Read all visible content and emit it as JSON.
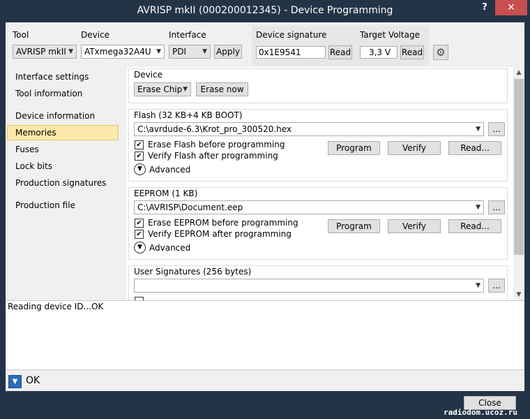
{
  "window": {
    "title": "AVRISP mkII (000200012345) - Device Programming",
    "help_glyph": "?",
    "close_glyph": "✕"
  },
  "toolbar": {
    "tool_label": "Tool",
    "tool_value": "AVRISP mkII",
    "device_label": "Device",
    "device_value": "ATxmega32A4U",
    "interface_label": "Interface",
    "interface_value": "PDI",
    "apply_label": "Apply",
    "signature_label": "Device signature",
    "signature_value": "0x1E9541",
    "signature_read": "Read",
    "voltage_label": "Target Voltage",
    "voltage_value": "3,3 V",
    "voltage_read": "Read"
  },
  "nav": {
    "items": [
      "Interface settings",
      "Tool information",
      "Device information",
      "Memories",
      "Fuses",
      "Lock bits",
      "Production signatures",
      "Production file"
    ],
    "selected": "Memories"
  },
  "device_group": {
    "title": "Device",
    "erase_combo": "Erase Chip",
    "erase_now": "Erase now"
  },
  "flash_group": {
    "title": "Flash (32 KB+4 KB BOOT)",
    "path": "C:\\avrdude-6.3\\Krot_pro_300520.hex",
    "browse": "...",
    "erase_check": "Erase Flash before programming",
    "verify_check": "Verify Flash after programming",
    "advanced": "Advanced",
    "program": "Program",
    "verify": "Verify",
    "read": "Read..."
  },
  "eeprom_group": {
    "title": "EEPROM (1 KB)",
    "path": "C:\\AVRISP\\Document.eep",
    "browse": "...",
    "erase_check": "Erase EEPROM before programming",
    "verify_check": "Verify EEPROM after programming",
    "advanced": "Advanced",
    "program": "Program",
    "verify": "Verify",
    "read": "Read..."
  },
  "usersig_group": {
    "title": "User Signatures (256 bytes)",
    "path": "",
    "browse": "..."
  },
  "log": {
    "text": "Reading device ID...OK"
  },
  "status": {
    "text": "OK",
    "toggle_glyph": "▼"
  },
  "footer": {
    "close_label": "Close",
    "watermark": "radiodom.ucoz.ru"
  }
}
